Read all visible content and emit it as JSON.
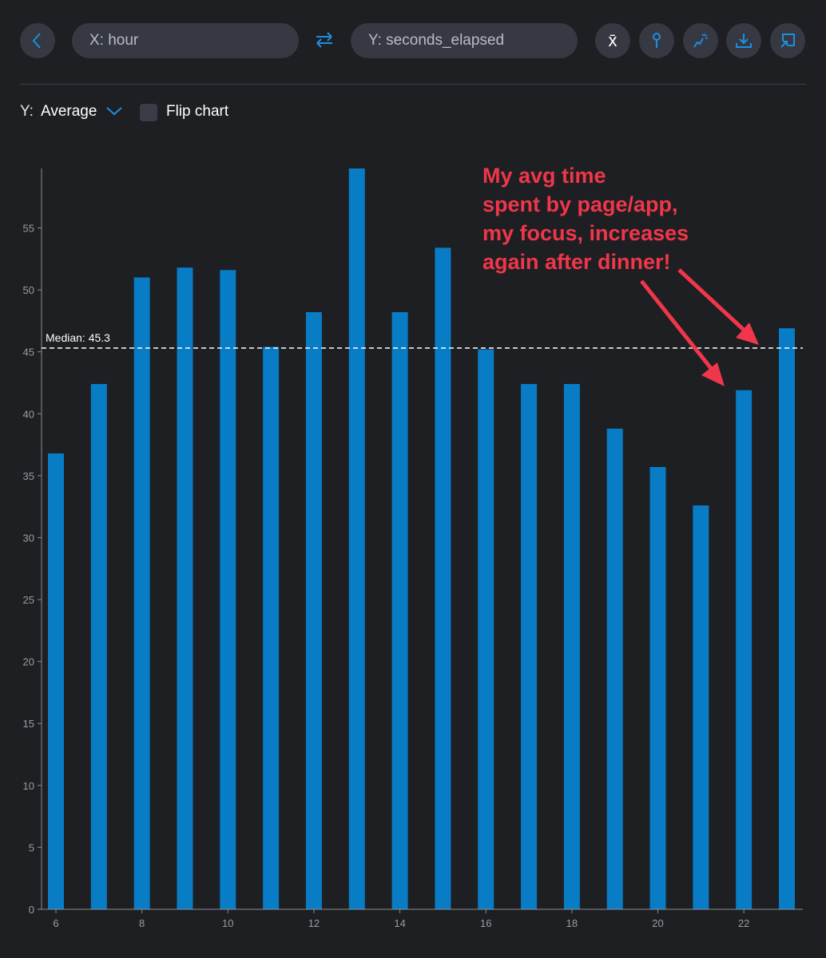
{
  "toolbar": {
    "back_icon": "chevron-left-icon",
    "x_field": "X: hour",
    "swap_icon": "swap-arrows-icon",
    "y_field": "Y: seconds_elapsed",
    "buttons": [
      "mean-icon",
      "pin-icon",
      "sparkle-trend-icon",
      "download-icon",
      "open-external-icon"
    ],
    "mean_glyph": "x̄",
    "accent": "#1e8fe0"
  },
  "controls": {
    "y_label": "Y:",
    "aggregation": "Average",
    "flip_label": "Flip chart",
    "flip_checked": false
  },
  "annotation": {
    "lines": [
      "My avg time",
      "spent by page/app,",
      "my focus, increases",
      "again after dinner!"
    ],
    "color": "#f0364a"
  },
  "chart_data": {
    "type": "bar",
    "categories": [
      6,
      7,
      8,
      9,
      10,
      11,
      12,
      13,
      14,
      15,
      16,
      17,
      18,
      19,
      20,
      21,
      22,
      23
    ],
    "values": [
      36.8,
      42.4,
      51.0,
      51.8,
      51.6,
      45.4,
      48.2,
      59.8,
      48.2,
      53.4,
      45.2,
      42.4,
      42.4,
      38.8,
      35.7,
      32.6,
      41.9,
      46.9
    ],
    "x_ticks": [
      6,
      8,
      10,
      12,
      14,
      16,
      18,
      20,
      22
    ],
    "y_ticks": [
      0,
      5,
      10,
      15,
      20,
      25,
      30,
      35,
      40,
      45,
      50,
      55
    ],
    "ylim": [
      0,
      59.8
    ],
    "bar_color": "#087cc4",
    "grid": false,
    "reference_line": {
      "label": "Median: 45.3",
      "value": 45.3
    }
  }
}
